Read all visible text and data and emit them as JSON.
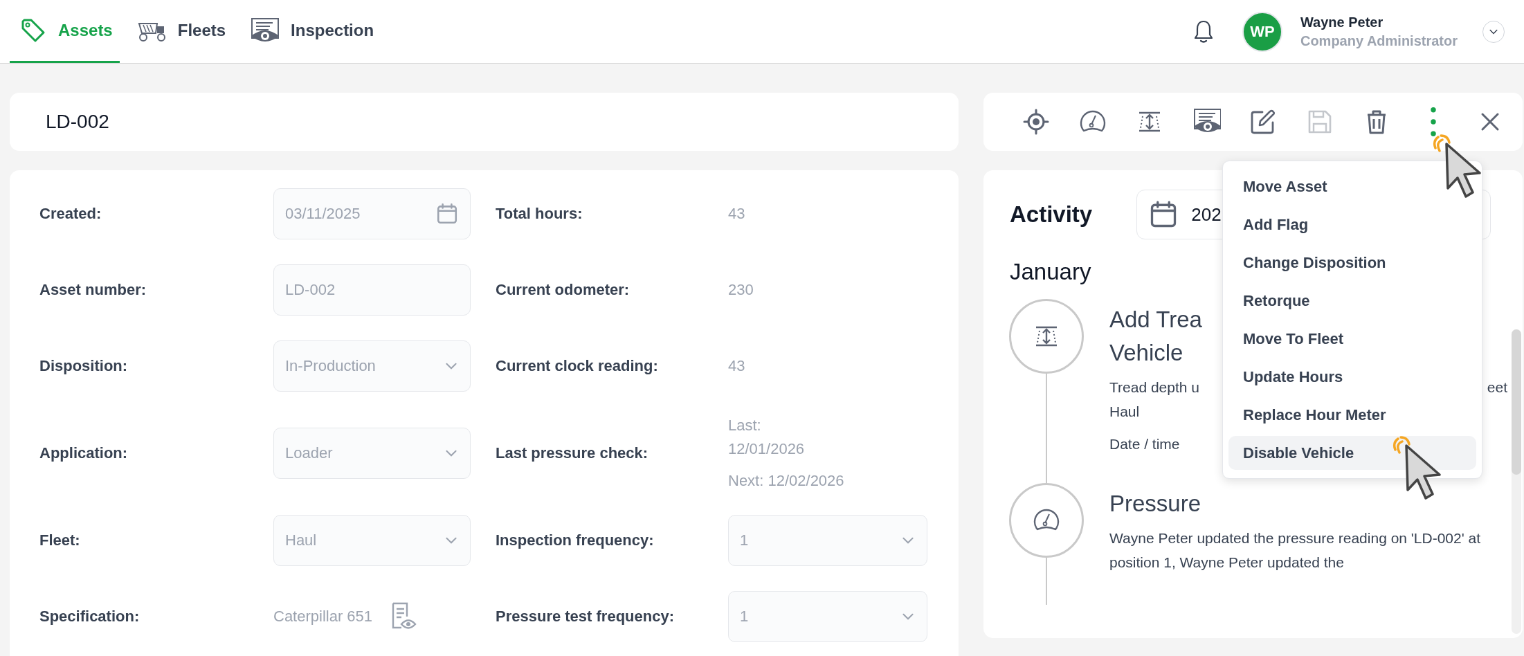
{
  "nav": {
    "tabs": [
      {
        "label": "Assets",
        "selected": true
      },
      {
        "label": "Fleets",
        "selected": false
      },
      {
        "label": "Inspection",
        "selected": false
      }
    ]
  },
  "user": {
    "initials": "WP",
    "name": "Wayne Peter",
    "role": "Company Administrator"
  },
  "asset": {
    "title": "LD-002"
  },
  "toolbar": {
    "buttons": [
      {
        "disabled": false
      },
      {
        "disabled": false
      },
      {
        "disabled": false
      },
      {
        "disabled": false
      },
      {
        "disabled": false
      },
      {
        "disabled": true
      },
      {
        "disabled": false
      },
      {
        "disabled": false
      },
      {
        "disabled": false
      }
    ]
  },
  "form": {
    "rows": [
      {
        "left": {
          "label": "Created:",
          "kind": "date",
          "value": "03/11/2025"
        },
        "right": {
          "label": "Total hours:",
          "kind": "text",
          "lines": [
            "43"
          ]
        }
      },
      {
        "left": {
          "label": "Asset number:",
          "kind": "input",
          "value": "LD-002"
        },
        "right": {
          "label": "Current odometer:",
          "kind": "text",
          "lines": [
            "230"
          ]
        }
      },
      {
        "left": {
          "label": "Disposition:",
          "kind": "select",
          "value": "In-Production"
        },
        "right": {
          "label": "Current clock reading:",
          "kind": "text",
          "lines": [
            "43"
          ]
        }
      },
      {
        "left": {
          "label": "Application:",
          "kind": "select",
          "value": "Loader"
        },
        "right": {
          "label": "Last pressure check:",
          "kind": "text",
          "lines": [
            "Last:",
            "12/01/2026",
            "Next: 12/02/2026"
          ]
        }
      },
      {
        "left": {
          "label": "Fleet:",
          "kind": "select",
          "value": "Haul"
        },
        "right": {
          "label": "Inspection frequency:",
          "kind": "select",
          "value": "1"
        }
      },
      {
        "left": {
          "label": "Specification:",
          "kind": "spec",
          "value": "Caterpillar 651"
        },
        "right": {
          "label": "Pressure test frequency:",
          "kind": "select",
          "value": "1"
        }
      }
    ]
  },
  "activity": {
    "title": "Activity",
    "date_value": "202",
    "month": "January",
    "events": [
      {
        "kind": "tread",
        "title_lines": [
          "Add Trea",
          "Vehicle"
        ],
        "description_start": "Tread depth u",
        "description_end": "eet",
        "description_line_2": "Haul",
        "date_label": "Date / time"
      },
      {
        "kind": "pressure",
        "title_lines": [
          "Pressure"
        ],
        "description": "Wayne Peter updated the pressure reading on 'LD-002' at position 1, Wayne Peter updated the"
      }
    ]
  },
  "menu": {
    "items": [
      {
        "label": "Move Asset",
        "highlighted": false
      },
      {
        "label": "Add Flag",
        "highlighted": false
      },
      {
        "label": "Change Disposition",
        "highlighted": false
      },
      {
        "label": "Retorque",
        "highlighted": false
      },
      {
        "label": "Move To Fleet",
        "highlighted": false
      },
      {
        "label": "Update Hours",
        "highlighted": false
      },
      {
        "label": "Replace Hour Meter",
        "highlighted": false
      },
      {
        "label": "Disable Vehicle",
        "highlighted": true
      }
    ]
  }
}
